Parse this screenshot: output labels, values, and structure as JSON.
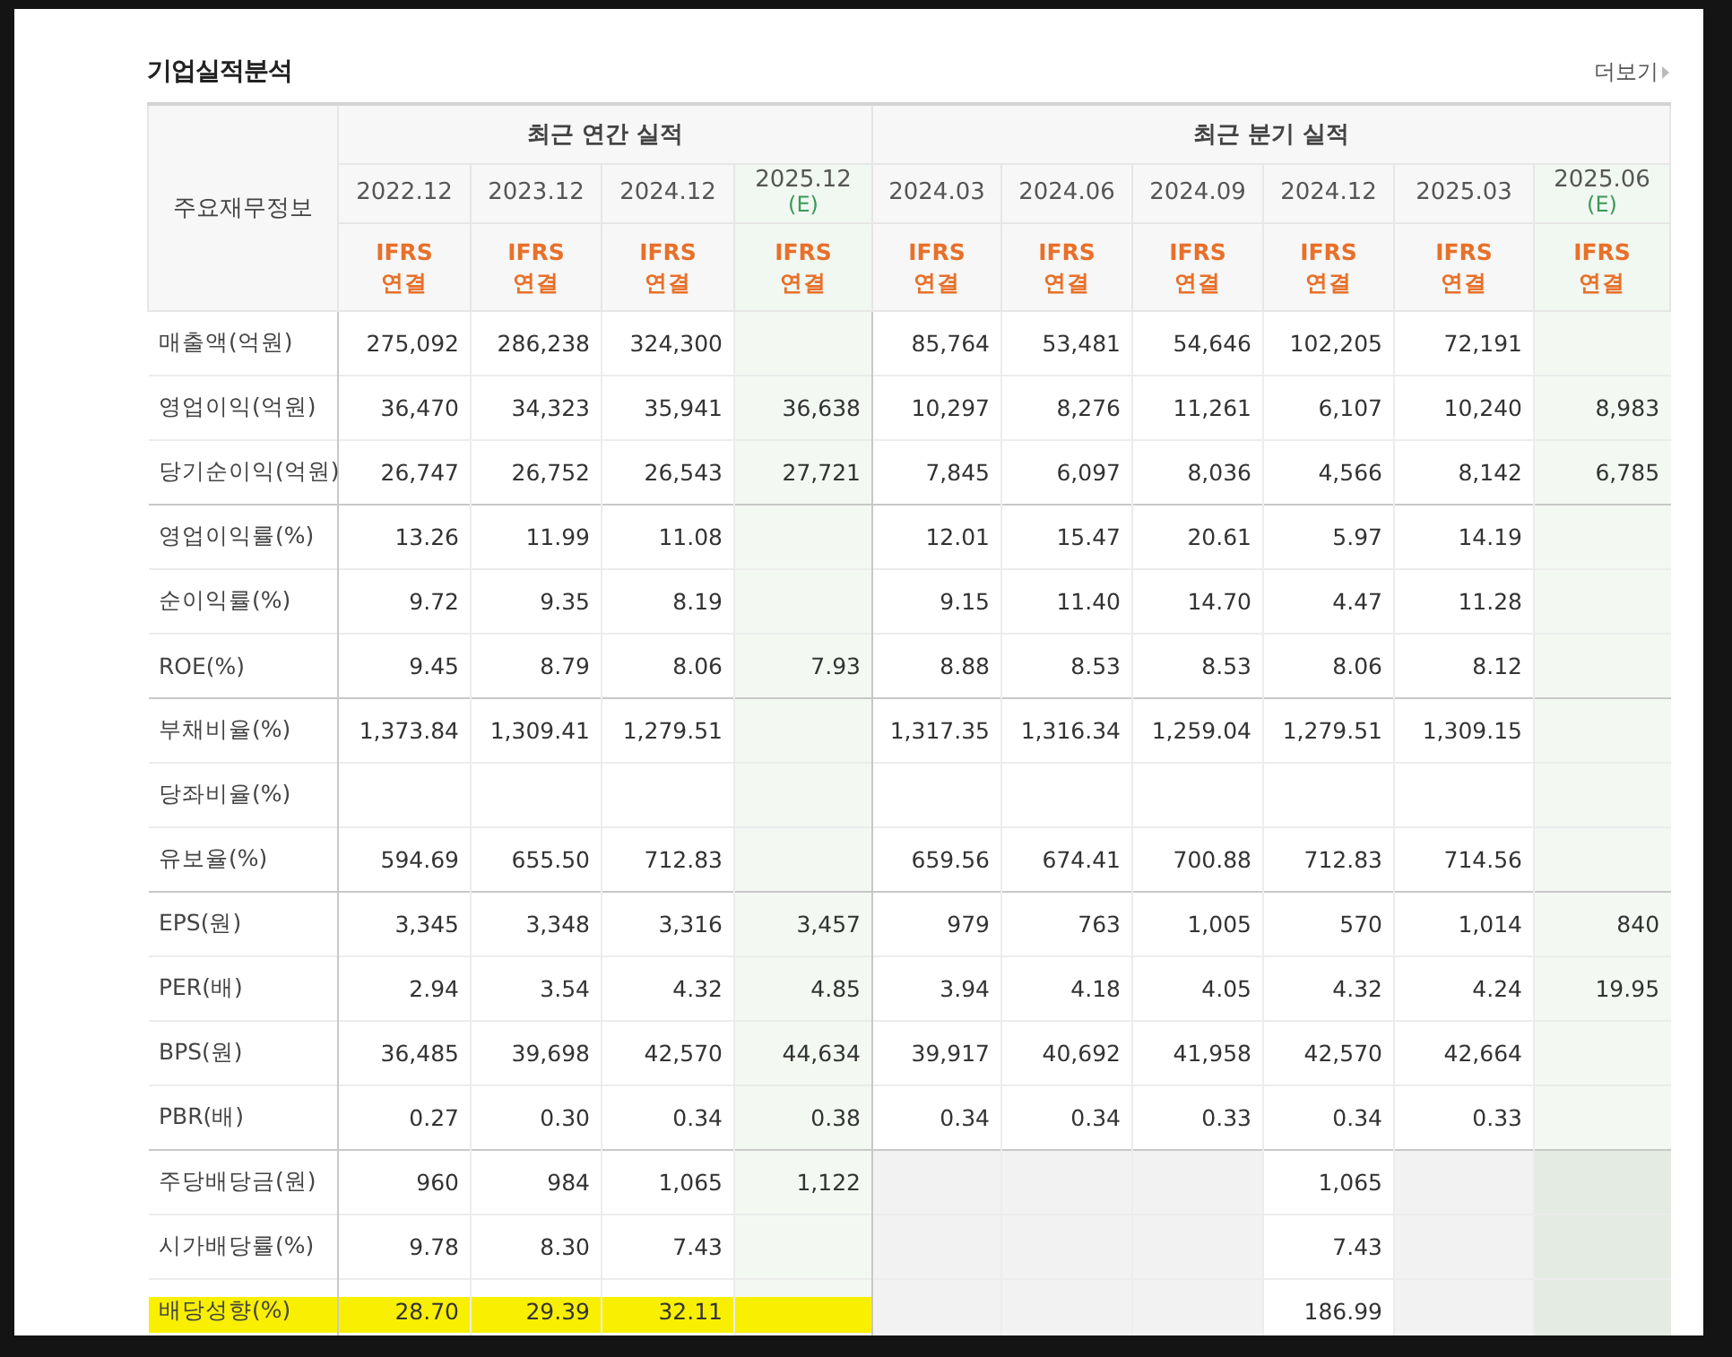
{
  "title": "기업실적분석",
  "more_link": "더보기",
  "corner_header": "주요재무정보",
  "sections": [
    {
      "title": "최근 연간 실적",
      "columns": [
        {
          "period": "2022.12",
          "standard": "IFRS",
          "consolidation": "연결"
        },
        {
          "period": "2023.12",
          "standard": "IFRS",
          "consolidation": "연결"
        },
        {
          "period": "2024.12",
          "standard": "IFRS",
          "consolidation": "연결"
        },
        {
          "period": "2025.12",
          "note": "(E)",
          "standard": "IFRS",
          "consolidation": "연결"
        }
      ]
    },
    {
      "title": "최근 분기 실적",
      "columns": [
        {
          "period": "2024.03",
          "standard": "IFRS",
          "consolidation": "연결"
        },
        {
          "period": "2024.06",
          "standard": "IFRS",
          "consolidation": "연결"
        },
        {
          "period": "2024.09",
          "standard": "IFRS",
          "consolidation": "연결"
        },
        {
          "period": "2024.12",
          "standard": "IFRS",
          "consolidation": "연결"
        },
        {
          "period": "2025.03",
          "standard": "IFRS",
          "consolidation": "연결"
        },
        {
          "period": "2025.06",
          "note": "(E)",
          "standard": "IFRS",
          "consolidation": "연결"
        }
      ]
    }
  ],
  "groups": [
    {
      "rows": [
        {
          "label": "매출액(억원)",
          "highlighted": false,
          "values": [
            "275,092",
            "286,238",
            "324,300",
            {
              "kind": "blank",
              "shaded": false
            },
            "85,764",
            "53,481",
            "54,646",
            "102,205",
            "72,191",
            {
              "kind": "blank",
              "shaded": false
            }
          ]
        },
        {
          "label": "영업이익(억원)",
          "highlighted": false,
          "values": [
            "36,470",
            "34,323",
            "35,941",
            "36,638",
            "10,297",
            "8,276",
            "11,261",
            "6,107",
            "10,240",
            "8,983"
          ]
        },
        {
          "label": "당기순이익(억원)",
          "highlighted": false,
          "values": [
            "26,747",
            "26,752",
            "26,543",
            "27,721",
            "7,845",
            "6,097",
            "8,036",
            "4,566",
            "8,142",
            "6,785"
          ]
        }
      ]
    },
    {
      "rows": [
        {
          "label": "영업이익률(%)",
          "highlighted": false,
          "values": [
            "13.26",
            "11.99",
            "11.08",
            {
              "kind": "blank",
              "shaded": false
            },
            "12.01",
            "15.47",
            "20.61",
            "5.97",
            "14.19",
            {
              "kind": "blank",
              "shaded": false
            }
          ]
        },
        {
          "label": "순이익률(%)",
          "highlighted": false,
          "values": [
            "9.72",
            "9.35",
            "8.19",
            {
              "kind": "blank",
              "shaded": false
            },
            "9.15",
            "11.40",
            "14.70",
            "4.47",
            "11.28",
            {
              "kind": "blank",
              "shaded": false
            }
          ]
        },
        {
          "label": "ROE(%)",
          "highlighted": false,
          "values": [
            "9.45",
            "8.79",
            "8.06",
            "7.93",
            "8.88",
            "8.53",
            "8.53",
            "8.06",
            "8.12",
            {
              "kind": "blank",
              "shaded": false
            }
          ]
        }
      ]
    },
    {
      "rows": [
        {
          "label": "부채비율(%)",
          "highlighted": false,
          "values": [
            "1,373.84",
            "1,309.41",
            "1,279.51",
            {
              "kind": "blank",
              "shaded": false
            },
            "1,317.35",
            "1,316.34",
            "1,259.04",
            "1,279.51",
            "1,309.15",
            {
              "kind": "blank",
              "shaded": false
            }
          ]
        },
        {
          "label": "당좌비율(%)",
          "highlighted": false,
          "values": [
            {
              "kind": "blank",
              "shaded": false
            },
            {
              "kind": "blank",
              "shaded": false
            },
            {
              "kind": "blank",
              "shaded": false
            },
            {
              "kind": "blank",
              "shaded": false
            },
            {
              "kind": "blank",
              "shaded": false
            },
            {
              "kind": "blank",
              "shaded": false
            },
            {
              "kind": "blank",
              "shaded": false
            },
            {
              "kind": "blank",
              "shaded": false
            },
            {
              "kind": "blank",
              "shaded": false
            },
            {
              "kind": "blank",
              "shaded": false
            }
          ]
        },
        {
          "label": "유보율(%)",
          "highlighted": false,
          "values": [
            "594.69",
            "655.50",
            "712.83",
            {
              "kind": "blank",
              "shaded": false
            },
            "659.56",
            "674.41",
            "700.88",
            "712.83",
            "714.56",
            {
              "kind": "blank",
              "shaded": false
            }
          ]
        }
      ]
    },
    {
      "rows": [
        {
          "label": "EPS(원)",
          "highlighted": false,
          "values": [
            "3,345",
            "3,348",
            "3,316",
            "3,457",
            "979",
            "763",
            "1,005",
            "570",
            "1,014",
            "840"
          ]
        },
        {
          "label": "PER(배)",
          "highlighted": false,
          "values": [
            "2.94",
            "3.54",
            "4.32",
            "4.85",
            "3.94",
            "4.18",
            "4.05",
            "4.32",
            "4.24",
            "19.95"
          ]
        },
        {
          "label": "BPS(원)",
          "highlighted": false,
          "values": [
            "36,485",
            "39,698",
            "42,570",
            "44,634",
            "39,917",
            "40,692",
            "41,958",
            "42,570",
            "42,664",
            {
              "kind": "blank",
              "shaded": false
            }
          ]
        },
        {
          "label": "PBR(배)",
          "highlighted": false,
          "values": [
            "0.27",
            "0.30",
            "0.34",
            "0.38",
            "0.34",
            "0.34",
            "0.33",
            "0.34",
            "0.33",
            {
              "kind": "blank",
              "shaded": false
            }
          ]
        }
      ]
    },
    {
      "rows": [
        {
          "label": "주당배당금(원)",
          "highlighted": false,
          "values": [
            "960",
            "984",
            "1,065",
            "1,122",
            {
              "kind": "blank",
              "shaded": true
            },
            {
              "kind": "blank",
              "shaded": true
            },
            {
              "kind": "blank",
              "shaded": true
            },
            "1,065",
            {
              "kind": "blank",
              "shaded": true
            },
            {
              "kind": "blank",
              "shaded": true
            }
          ]
        },
        {
          "label": "시가배당률(%)",
          "highlighted": false,
          "values": [
            "9.78",
            "8.30",
            "7.43",
            {
              "kind": "blank",
              "shaded": false
            },
            {
              "kind": "blank",
              "shaded": true
            },
            {
              "kind": "blank",
              "shaded": true
            },
            {
              "kind": "blank",
              "shaded": true
            },
            "7.43",
            {
              "kind": "blank",
              "shaded": true
            },
            {
              "kind": "blank",
              "shaded": true
            }
          ]
        },
        {
          "label": "배당성향(%)",
          "highlighted": true,
          "values": [
            "28.70",
            "29.39",
            "32.11",
            {
              "kind": "blank",
              "shaded": false
            },
            {
              "kind": "blank",
              "shaded": true
            },
            {
              "kind": "blank",
              "shaded": true
            },
            {
              "kind": "blank",
              "shaded": true
            },
            "186.99",
            {
              "kind": "blank",
              "shaded": true
            },
            {
              "kind": "blank",
              "shaded": true
            }
          ]
        }
      ]
    }
  ]
}
